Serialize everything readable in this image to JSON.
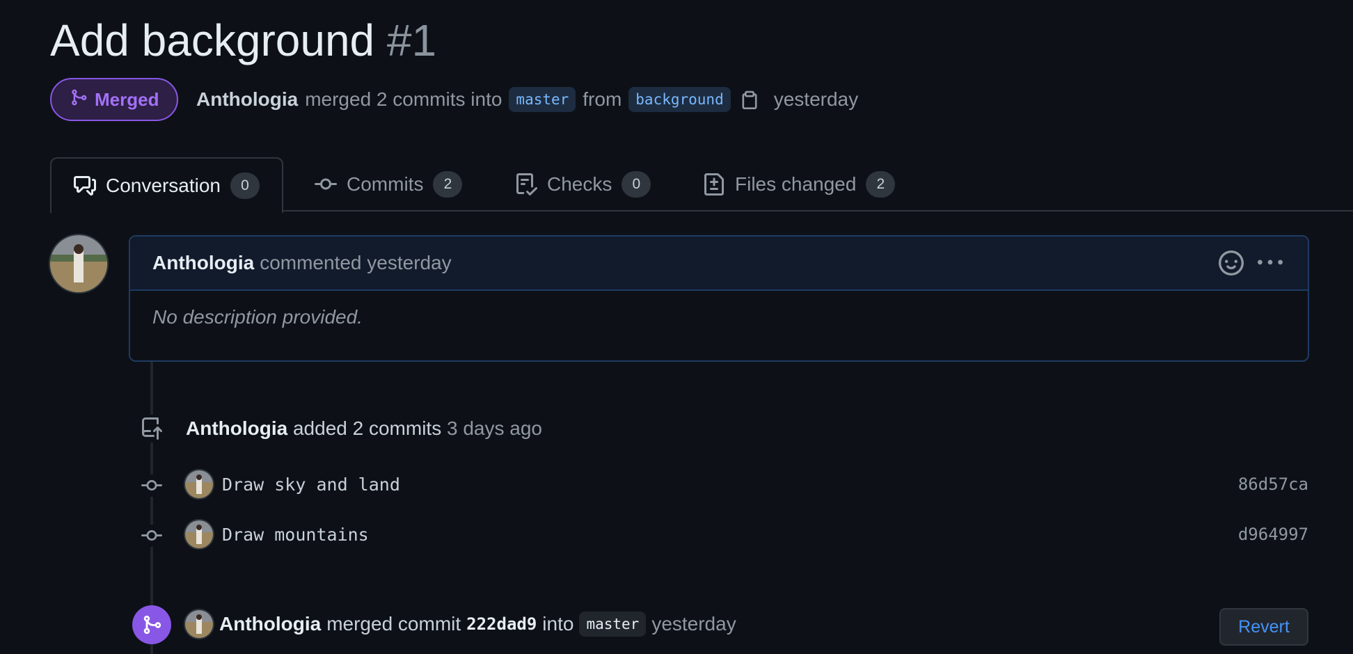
{
  "pr": {
    "title": "Add background",
    "number": "#1",
    "state": "Merged",
    "author": "Anthologia",
    "merge_text": "merged 2 commits into",
    "base_branch": "master",
    "from_text": "from",
    "head_branch": "background",
    "time": "yesterday"
  },
  "tabs": [
    {
      "label": "Conversation",
      "count": "0",
      "icon": "comment-discussion-icon",
      "active": true
    },
    {
      "label": "Commits",
      "count": "2",
      "icon": "git-commit-icon",
      "active": false
    },
    {
      "label": "Checks",
      "count": "0",
      "icon": "checklist-icon",
      "active": false
    },
    {
      "label": "Files changed",
      "count": "2",
      "icon": "file-diff-icon",
      "active": false
    }
  ],
  "comment": {
    "author": "Anthologia",
    "action": "commented",
    "time": "yesterday",
    "body": "No description provided."
  },
  "commits_event": {
    "author": "Anthologia",
    "action": "added 2 commits",
    "time": "3 days ago",
    "commits": [
      {
        "message": "Draw sky and land",
        "sha": "86d57ca"
      },
      {
        "message": "Draw mountains",
        "sha": "d964997"
      }
    ]
  },
  "merge_event": {
    "author": "Anthologia",
    "action": "merged commit",
    "sha": "222dad9",
    "into_text": "into",
    "branch": "master",
    "time": "yesterday",
    "revert_label": "Revert"
  },
  "colors": {
    "background": "#0d1117",
    "merged_purple": "#8957e5",
    "link_blue": "#4493f8",
    "muted_text": "#9198a1"
  }
}
